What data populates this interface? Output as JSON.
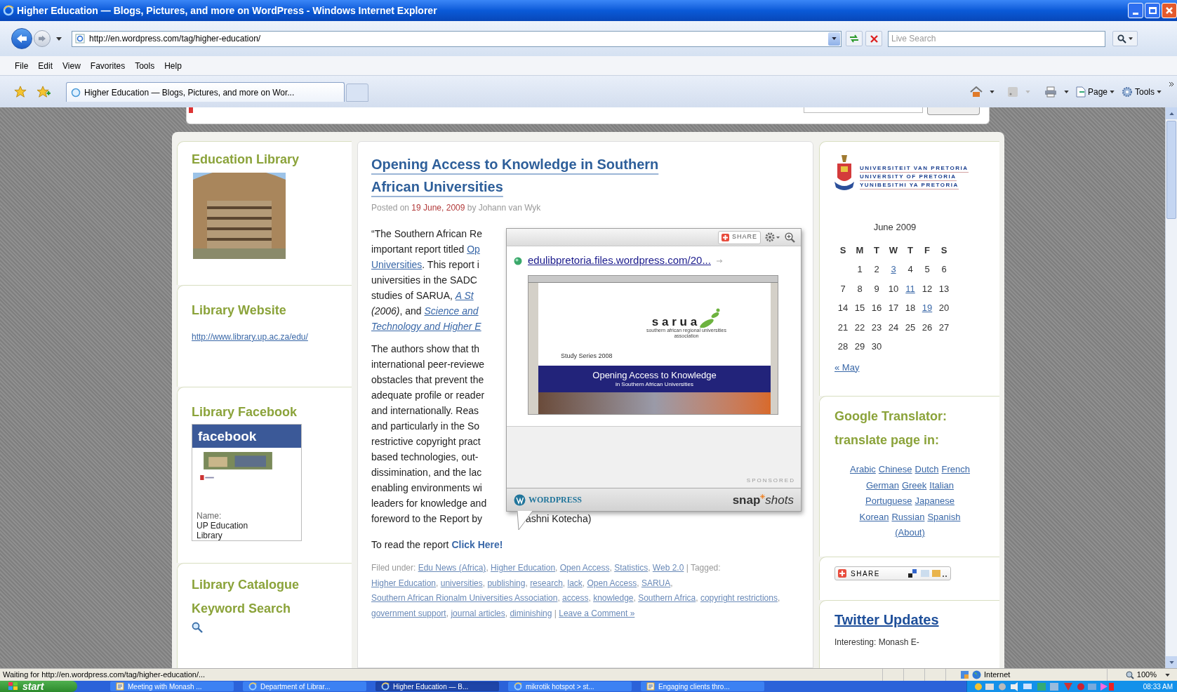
{
  "window": {
    "title": "Higher Education — Blogs, Pictures, and more on WordPress - Windows Internet Explorer"
  },
  "address_bar": {
    "url": "http://en.wordpress.com/tag/higher-education/",
    "search_placeholder": "Live Search"
  },
  "menu": [
    "File",
    "Edit",
    "View",
    "Favorites",
    "Tools",
    "Help"
  ],
  "tabs": [
    {
      "label": "Higher Education — Blogs, Pictures, and more on Wor...",
      "selected": true
    }
  ],
  "command_bar": {
    "page": "Page",
    "tools": "Tools"
  },
  "sidebar_left": [
    {
      "kind": "image",
      "title": "Education Library"
    },
    {
      "kind": "link",
      "title": "Library Website",
      "link": "http://www.library.up.ac.za/edu/"
    },
    {
      "kind": "facebook",
      "title": "Library Facebook",
      "brand": "facebook",
      "name_label": "Name:",
      "name_value": "UP Education Library"
    },
    {
      "kind": "search",
      "title": "Library Catalogue Keyword Search"
    }
  ],
  "post": {
    "title": "Opening Access to Knowledge in Southern African Universities",
    "posted_prefix": "Posted on ",
    "date": "19 June, 2009",
    "posted_suffix": " by Johann van Wyk",
    "paragraphs": [
      [
        [
          {
            "kind": "text",
            "text": "“The Southern African Re"
          }
        ],
        [
          {
            "kind": "text",
            "text": "important report titled "
          },
          {
            "kind": "link",
            "text": "Op"
          }
        ],
        [
          {
            "kind": "link",
            "text": "Universities"
          },
          {
            "kind": "text",
            "text": ". This report i"
          }
        ],
        [
          {
            "kind": "text",
            "text": "universities in the SADC"
          }
        ],
        [
          {
            "kind": "text",
            "text": "studies of  SARUA, "
          },
          {
            "kind": "link-italic",
            "text": "A St"
          }
        ],
        [
          {
            "kind": "italic",
            "text": "(2006)"
          },
          {
            "kind": "text",
            "text": ", and "
          },
          {
            "kind": "link-italic",
            "text": "Science and"
          }
        ],
        [
          {
            "kind": "link-italic",
            "text": "Technology and Higher E"
          }
        ]
      ],
      [
        [
          {
            "kind": "text",
            "text": "The authors show that th"
          }
        ],
        [
          {
            "kind": "text",
            "text": "international peer-reviewe"
          }
        ],
        [
          {
            "kind": "text",
            "text": "obstacles that prevent the"
          }
        ],
        [
          {
            "kind": "text",
            "text": "adequate profile or reader"
          }
        ],
        [
          {
            "kind": "text",
            "text": "and internationally. Reas"
          }
        ],
        [
          {
            "kind": "text",
            "text": "and particularly in the So"
          }
        ],
        [
          {
            "kind": "text",
            "text": "restrictive copyright pract"
          }
        ],
        [
          {
            "kind": "text",
            "text": "based technologies, out-"
          }
        ],
        [
          {
            "kind": "text",
            "text": "dissimination, and the lac"
          }
        ],
        [
          {
            "kind": "text",
            "text": "enabling environments wi"
          }
        ],
        [
          {
            "kind": "text",
            "text": "leaders for knowledge and"
          }
        ],
        [
          {
            "kind": "text",
            "text": "foreword to the Report by"
          },
          {
            "kind": "gap",
            "text": "ashni Kotecha)"
          }
        ]
      ]
    ],
    "read_more": {
      "text": "To read the report ",
      "link": "Click Here!"
    },
    "meta": {
      "filed_label": "Filed under: ",
      "separator": ", ",
      "tagged_label": " | Tagged: ",
      "end_bar": " | ",
      "categories": [
        "Edu News (Africa)",
        "Higher Education",
        "Open Access",
        "Statistics",
        "Web 2.0"
      ],
      "tags": [
        "Higher Education",
        "universities",
        "publishing",
        "research",
        "lack",
        "Open Access",
        "SARUA",
        "Southern African Rionalm Universities Association",
        "access",
        "knowledge",
        "Southern Africa",
        "copyright restrictions",
        "government support",
        "journal articles",
        "diminishing"
      ],
      "comment_link": "Leave a Comment »"
    }
  },
  "popup": {
    "share": "SHARE",
    "url": "edulibpretoria.files.wordpress.com/20...",
    "preview": {
      "logo": "s a r u a",
      "association": "southern african regional universities association",
      "series": "Study Series 2008",
      "title": "Opening Access to Knowledge",
      "subtitle": "in Southern African Universities"
    },
    "sponsored": "SPONSORED",
    "left_brand": "WORDPRESS",
    "right_brand": [
      "snap",
      "shots"
    ]
  },
  "university_logo": [
    "UNIVERSITEIT VAN PRETORIA",
    "UNIVERSITY OF PRETORIA",
    "YUNIBESITHI YA PRETORIA"
  ],
  "calendar": {
    "caption": "June 2009",
    "weekdays": [
      "S",
      "M",
      "T",
      "W",
      "T",
      "F",
      "S"
    ],
    "weeks": [
      [
        {
          "day": "1",
          "link": false
        },
        {
          "day": "2",
          "link": false
        },
        {
          "day": "3",
          "link": true
        },
        {
          "day": "4",
          "link": false
        },
        {
          "day": "5",
          "link": false
        },
        {
          "day": "6",
          "link": false
        }
      ],
      [
        {
          "day": "7",
          "link": false
        },
        {
          "day": "8",
          "link": false
        },
        {
          "day": "9",
          "link": false
        },
        {
          "day": "10",
          "link": false
        },
        {
          "day": "11",
          "link": true
        },
        {
          "day": "12",
          "link": false
        },
        {
          "day": "13",
          "link": false
        }
      ],
      [
        {
          "day": "14",
          "link": false
        },
        {
          "day": "15",
          "link": false
        },
        {
          "day": "16",
          "link": false
        },
        {
          "day": "17",
          "link": false
        },
        {
          "day": "18",
          "link": false
        },
        {
          "day": "19",
          "link": true
        },
        {
          "day": "20",
          "link": false
        }
      ],
      [
        {
          "day": "21",
          "link": false
        },
        {
          "day": "22",
          "link": false
        },
        {
          "day": "23",
          "link": false
        },
        {
          "day": "24",
          "link": false
        },
        {
          "day": "25",
          "link": false
        },
        {
          "day": "26",
          "link": false
        },
        {
          "day": "27",
          "link": false
        }
      ],
      [
        {
          "day": "28",
          "link": false
        },
        {
          "day": "29",
          "link": false
        },
        {
          "day": "30",
          "link": false
        }
      ]
    ],
    "prev": "« May"
  },
  "translator": {
    "title": "Google Translator: translate page in:",
    "rows": [
      [
        "Arabic",
        "Chinese",
        "Dutch",
        "French"
      ],
      [
        "German",
        "Greek",
        "Italian"
      ],
      [
        "Portuguese",
        "Japanese"
      ],
      [
        "Korean",
        "Russian",
        "Spanish"
      ]
    ],
    "about": "(About)"
  },
  "share_widget": {
    "label": "SHARE"
  },
  "twitter": {
    "title": "Twitter Updates",
    "first_tweet": "Interesting: Monash E-"
  },
  "status_bar": {
    "text": "Waiting for http://en.wordpress.com/tag/higher-education/...",
    "zone": "Internet",
    "zoom": "100%"
  },
  "taskbar": {
    "start": "start",
    "clock": "08:33 AM",
    "items": [
      {
        "label": "Meeting with Monash ...",
        "kind": "document",
        "selected": false
      },
      {
        "label": "Department of Librar...",
        "kind": "browser",
        "selected": false
      },
      {
        "label": "Higher Education — B...",
        "kind": "browser",
        "selected": true
      },
      {
        "label": "mikrotik hotspot > st...",
        "kind": "browser",
        "selected": false
      },
      {
        "label": "Engaging clients thro...",
        "kind": "document",
        "selected": false
      }
    ]
  }
}
